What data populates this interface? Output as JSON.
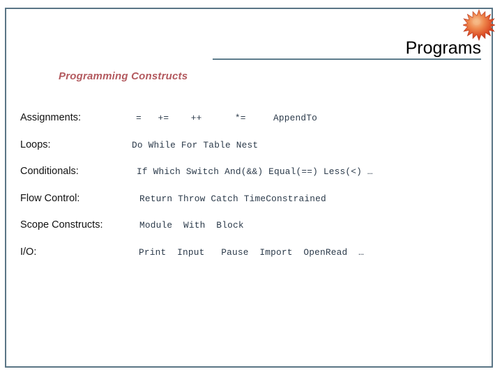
{
  "slide": {
    "title": "Programs",
    "subtitle": "Programming Constructs",
    "accent_color": "#b35a5f",
    "rule_color": "#5d7c8c",
    "frame_color": "#5a7585",
    "title_color": "#000000",
    "code_color": "#2b3a4a",
    "background_color": "#ffffff"
  },
  "decorations": {
    "starburst_icon": "starburst-icon",
    "starburst_color_outer": "#d94a28",
    "starburst_color_inner": "#f2a86b"
  },
  "constructs": {
    "rows": [
      {
        "label": "Assignments:",
        "values": "=   +=    ++      *=     AppendTo"
      },
      {
        "label": "Loops:",
        "values": "Do While For Table Nest"
      },
      {
        "label": "Conditionals:",
        "values": "If Which Switch And(&&) Equal(==) Less(<) …"
      },
      {
        "label": "Flow Control:",
        "values": "Return Throw Catch TimeConstrained"
      },
      {
        "label": "Scope Constructs:",
        "values": "Module  With  Block"
      },
      {
        "label": "I/O:",
        "values": "Print  Input   Pause  Import  OpenRead  …"
      }
    ]
  }
}
